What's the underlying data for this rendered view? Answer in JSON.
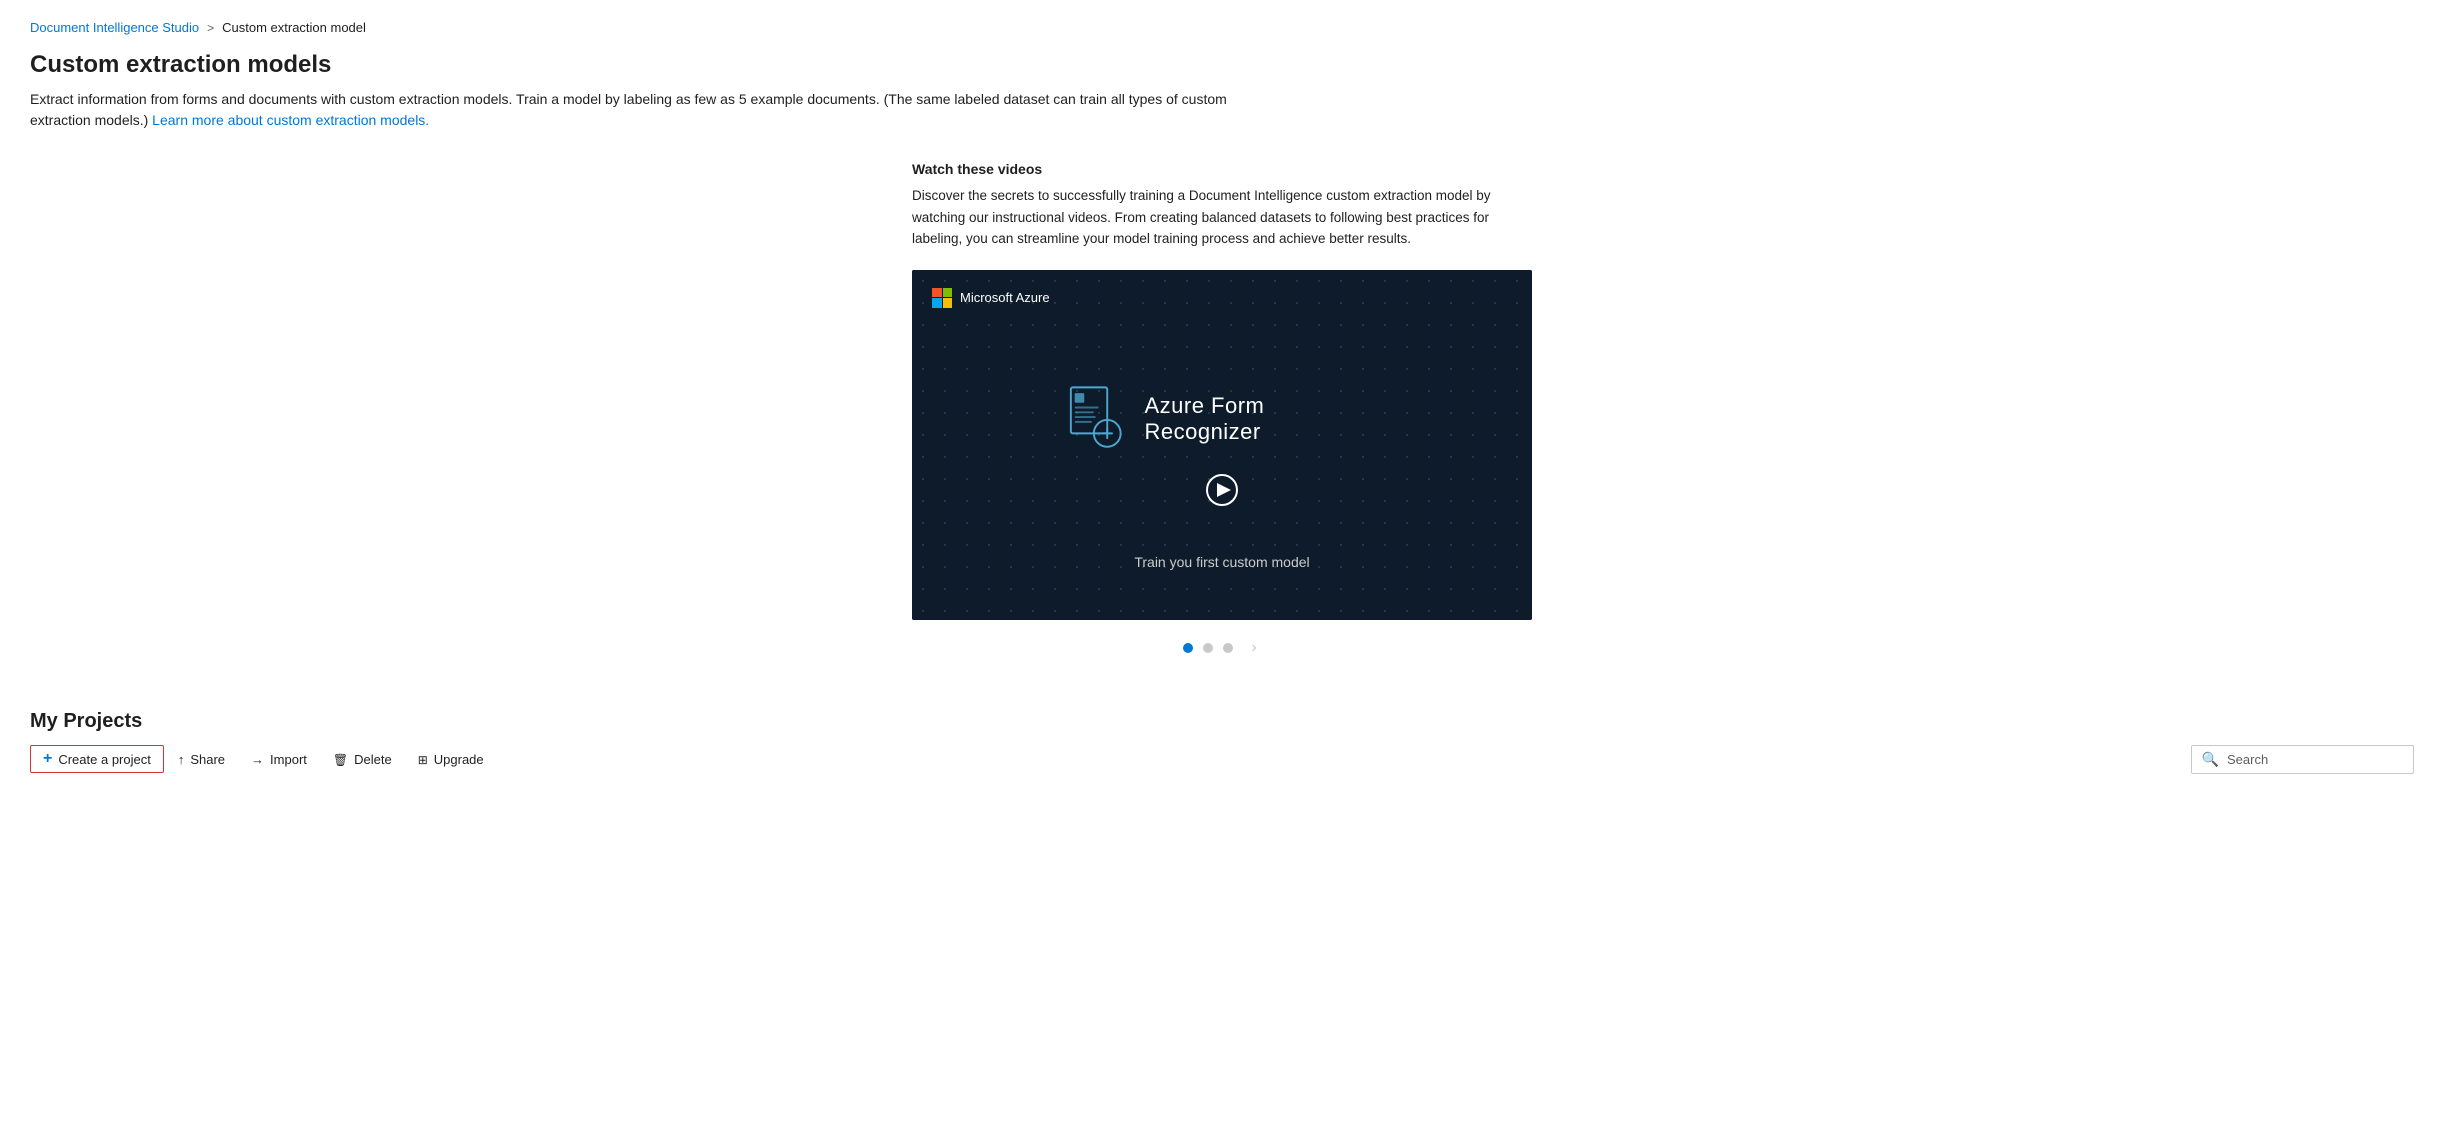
{
  "breadcrumb": {
    "parent_label": "Document Intelligence Studio",
    "separator": ">",
    "current": "Custom extraction model"
  },
  "page": {
    "title": "Custom extraction models",
    "description": "Extract information from forms and documents with custom extraction models. Train a model by labeling as few as 5 example documents. (The same labeled dataset can train all types of custom extraction models.)",
    "learn_more_link": "Learn more about custom extraction models."
  },
  "video_section": {
    "intro_title": "Watch these videos",
    "intro_description": "Discover the secrets to successfully training a Document Intelligence custom extraction model by watching our instructional videos. From creating balanced datasets to following best practices for labeling, you can streamline your model training process and achieve better results.",
    "azure_brand": "Microsoft Azure",
    "video_title": "Azure Form Recognizer",
    "video_subtitle": "Train you first custom model",
    "carousel_dots": [
      "active",
      "inactive",
      "inactive"
    ]
  },
  "my_projects": {
    "title": "My Projects",
    "toolbar": {
      "create_label": "Create a project",
      "share_label": "Share",
      "import_label": "Import",
      "delete_label": "Delete",
      "upgrade_label": "Upgrade"
    },
    "search": {
      "placeholder": "Search"
    }
  }
}
